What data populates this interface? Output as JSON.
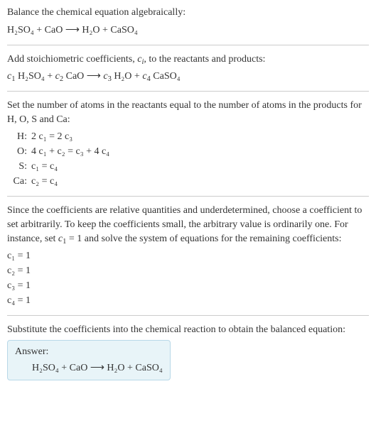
{
  "section1": {
    "intro": "Balance the chemical equation algebraically:",
    "eq": "H₂SO₄ + CaO ⟶ H₂O + CaSO₄"
  },
  "section2": {
    "intro_a": "Add stoichiometric coefficients, ",
    "intro_ci": "c",
    "intro_ci_sub": "i",
    "intro_b": ", to the reactants and products:",
    "eq_parts": {
      "c1": "c",
      "s1": "1",
      "sp1": " H₂SO₄ + ",
      "c2": "c",
      "s2": "2",
      "sp2": " CaO ⟶ ",
      "c3": "c",
      "s3": "3",
      "sp3": " H₂O + ",
      "c4": "c",
      "s4": "4",
      "sp4": " CaSO₄"
    }
  },
  "section3": {
    "intro": "Set the number of atoms in the reactants equal to the number of atoms in the products for H, O, S and Ca:",
    "rows": [
      {
        "label": "H:",
        "eq": "2 c₁ = 2 c₃"
      },
      {
        "label": "O:",
        "eq": "4 c₁ + c₂ = c₃ + 4 c₄"
      },
      {
        "label": "S:",
        "eq": "c₁ = c₄"
      },
      {
        "label": "Ca:",
        "eq": "c₂ = c₄"
      }
    ]
  },
  "section4": {
    "intro_a": "Since the coefficients are relative quantities and underdetermined, choose a coefficient to set arbitrarily. To keep the coefficients small, the arbitrary value is ordinarily one. For instance, set ",
    "set_c": "c",
    "set_sub": "1",
    "set_eq": " = 1",
    "intro_b": " and solve the system of equations for the remaining coefficients:",
    "coeffs": [
      "c₁ = 1",
      "c₂ = 1",
      "c₃ = 1",
      "c₄ = 1"
    ]
  },
  "section5": {
    "intro": "Substitute the coefficients into the chemical reaction to obtain the balanced equation:",
    "answer_label": "Answer:",
    "answer_eq": "H₂SO₄ + CaO ⟶ H₂O + CaSO₄"
  }
}
